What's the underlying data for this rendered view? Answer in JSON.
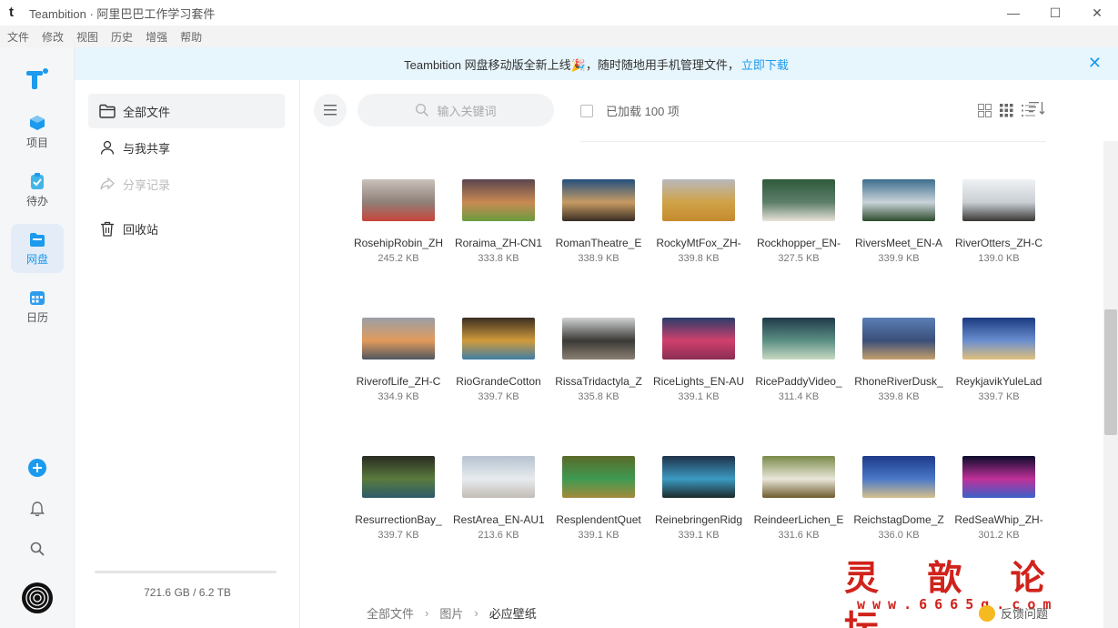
{
  "window": {
    "app_icon": "t",
    "title": "Teambition · 阿里巴巴工作学习套件",
    "controls": {
      "minimize": "—",
      "maximize": "☐",
      "close": "✕"
    }
  },
  "menu": [
    "文件",
    "修改",
    "视图",
    "历史",
    "增强",
    "帮助"
  ],
  "rail": {
    "items": [
      {
        "label": "项目",
        "icon": "cube-icon",
        "color": "#1b9aee"
      },
      {
        "label": "待办",
        "icon": "clipboard-icon",
        "color": "#41b5e8"
      },
      {
        "label": "网盘",
        "icon": "folder-icon",
        "color": "#1b9aee",
        "active": true
      },
      {
        "label": "日历",
        "icon": "calendar-icon",
        "color": "#2d9cec"
      }
    ],
    "brand_color": "#1b9aee"
  },
  "banner": {
    "text": "Teambition 网盘移动版全新上线🎉，随时随地用手机管理文件，",
    "link": "立即下载",
    "close": "✕"
  },
  "sidebar": {
    "items": [
      {
        "label": "全部文件",
        "icon": "folder-outline-icon",
        "active": true
      },
      {
        "label": "与我共享",
        "icon": "user-icon"
      },
      {
        "label": "分享记录",
        "icon": "share-icon",
        "disabled": true
      },
      {
        "label": "回收站",
        "icon": "trash-icon"
      }
    ],
    "storage": "721.6 GB / 6.2 TB"
  },
  "toolbar": {
    "search_placeholder": "输入关键词",
    "loaded": "已加载 100 项"
  },
  "files": [
    {
      "name": "RosehipRobin_ZH",
      "size": "245.2 KB",
      "colors": [
        "#c9c2bb",
        "#8f8078",
        "#c8453a"
      ]
    },
    {
      "name": "Roraima_ZH-CN1",
      "size": "333.8 KB",
      "colors": [
        "#5a4550",
        "#c98a52",
        "#6a9c3f"
      ]
    },
    {
      "name": "RomanTheatre_E",
      "size": "338.9 KB",
      "colors": [
        "#23507e",
        "#c79b63",
        "#3a2e24"
      ]
    },
    {
      "name": "RockyMtFox_ZH-",
      "size": "339.8 KB",
      "colors": [
        "#b8b9bd",
        "#d0a248",
        "#c58a2e"
      ]
    },
    {
      "name": "Rockhopper_EN-",
      "size": "327.5 KB",
      "colors": [
        "#2f5a3a",
        "#5c7e6a",
        "#e8e2d8"
      ]
    },
    {
      "name": "RiversMeet_EN-A",
      "size": "339.9 KB",
      "colors": [
        "#3d6e8e",
        "#c9d3d9",
        "#2d4c2e"
      ]
    },
    {
      "name": "RiverOtters_ZH-C",
      "size": "139.0 KB",
      "colors": [
        "#f0f2f4",
        "#c9cfd4",
        "#3a3735"
      ]
    },
    {
      "name": "RiverofLife_ZH-C",
      "size": "334.9 KB",
      "colors": [
        "#9a9fa6",
        "#e29a5b",
        "#4f5660"
      ]
    },
    {
      "name": "RioGrandeCotton",
      "size": "339.7 KB",
      "colors": [
        "#3a2e22",
        "#d09a3a",
        "#3f7ea6"
      ]
    },
    {
      "name": "RissaTridactyla_Z",
      "size": "335.8 KB",
      "colors": [
        "#d1d2d3",
        "#3b3a37",
        "#8a8072"
      ]
    },
    {
      "name": "RiceLights_EN-AU",
      "size": "339.1 KB",
      "colors": [
        "#2b3d6a",
        "#d0406e",
        "#8a2d52"
      ]
    },
    {
      "name": "RicePaddyVideo_",
      "size": "311.4 KB",
      "colors": [
        "#203a4a",
        "#5a8f84",
        "#c7d9c2"
      ]
    },
    {
      "name": "RhoneRiverDusk_",
      "size": "339.8 KB",
      "colors": [
        "#5a7fb5",
        "#3b4e7a",
        "#c4a06a"
      ]
    },
    {
      "name": "ReykjavikYuleLad",
      "size": "339.7 KB",
      "colors": [
        "#1b3a80",
        "#6a8ed0",
        "#e0c07a"
      ]
    },
    {
      "name": "ResurrectionBay_",
      "size": "339.7 KB",
      "colors": [
        "#2a2a22",
        "#5a7b3e",
        "#2c5a6a"
      ]
    },
    {
      "name": "RestArea_EN-AU1",
      "size": "213.6 KB",
      "colors": [
        "#b6c3d0",
        "#e7ebee",
        "#c2bdb5"
      ]
    },
    {
      "name": "ResplendentQuet",
      "size": "339.1 KB",
      "colors": [
        "#5a6a2a",
        "#3e9a52",
        "#a48a3a"
      ]
    },
    {
      "name": "ReinebringenRidg",
      "size": "339.1 KB",
      "colors": [
        "#20324a",
        "#3b9ac2",
        "#1d2a2a"
      ]
    },
    {
      "name": "ReindeerLichen_E",
      "size": "331.6 KB",
      "colors": [
        "#7a8a4a",
        "#e9e7da",
        "#6e5a2e"
      ]
    },
    {
      "name": "ReichstagDome_Z",
      "size": "336.0 KB",
      "colors": [
        "#1e3a8a",
        "#4a78c8",
        "#d6c08a"
      ]
    },
    {
      "name": "RedSeaWhip_ZH-",
      "size": "301.2 KB",
      "colors": [
        "#0c0c2a",
        "#c0309a",
        "#3a62c8"
      ]
    }
  ],
  "breadcrumb": [
    "全部文件",
    "图片",
    "必应壁纸"
  ],
  "feedback": "反馈问题",
  "watermark": {
    "title": "灵 歆 论 坛",
    "url": "www.6665q.com"
  }
}
